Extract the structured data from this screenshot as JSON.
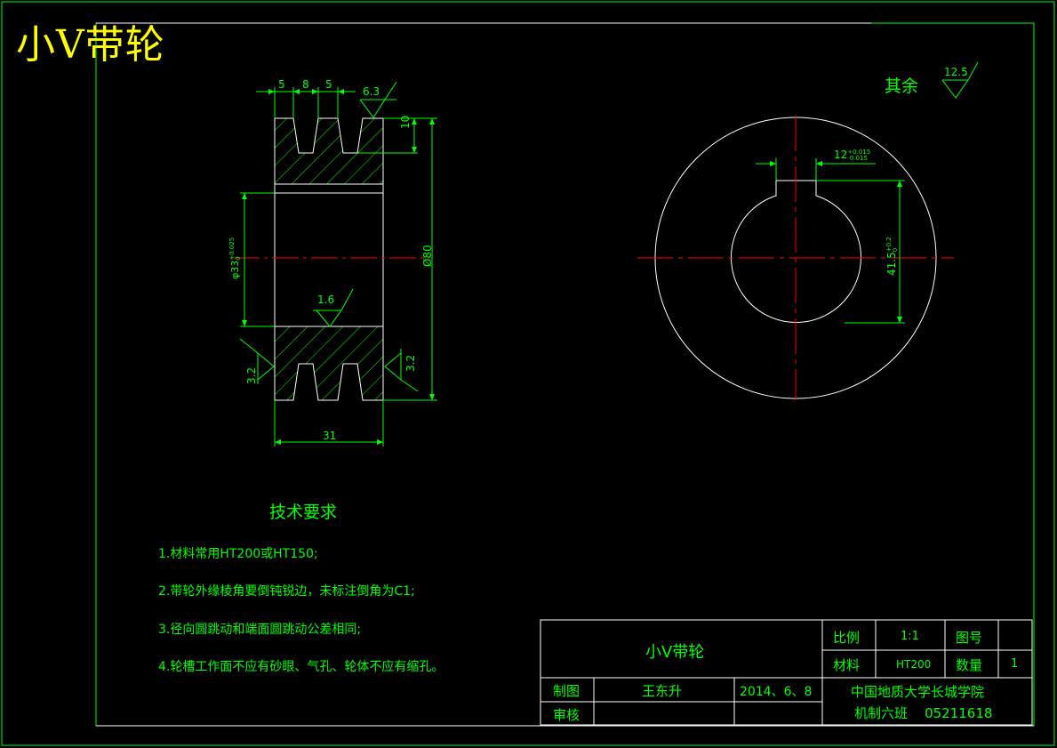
{
  "header": {
    "title": "小V带轮"
  },
  "drawing": {
    "section": {
      "dim_top": [
        "5",
        "8",
        "5"
      ],
      "roughness_top": "6.3",
      "dim_groove_depth": "10",
      "dim_bore": "φ33",
      "dim_bore_tol_upper": "+0.025",
      "dim_bore_tol_lower": "0",
      "dim_outer": "Ø80",
      "roughness_bore": "1.6",
      "roughness_left": "3.2",
      "roughness_right": "3.2",
      "dim_width": "31"
    },
    "end_view": {
      "dim_keyway": "12",
      "dim_keyway_tol_upper": "+0.015",
      "dim_keyway_tol_lower": "-0.015",
      "dim_keyhub": "41.5",
      "dim_keyhub_tol_upper": "+0.2",
      "dim_keyhub_tol_lower": "0"
    },
    "roughness_rest_label": "其余",
    "roughness_rest_value": "12.5"
  },
  "tech": {
    "title": "技术要求",
    "items": [
      "1.材料常用HT200或HT150;",
      "2.带轮外缘棱角要倒钝锐边，未标注倒角为C1;",
      "3.径向圆跳动和端面圆跳动公差相同;",
      "4.轮槽工作面不应有砂眼、气孔、轮体不应有缩孔。"
    ]
  },
  "title_block": {
    "part_name": "小V带轮",
    "scale_label": "比例",
    "scale_value": "1:1",
    "drawing_no_label": "图号",
    "drawing_no_value": "",
    "material_label": "材料",
    "material_value": "HT200",
    "qty_label": "数量",
    "qty_value": "1",
    "drawn_label": "制图",
    "drawn_name": "王东升",
    "drawn_date": "2014、6、8",
    "check_label": "审核",
    "org_line1": "中国地质大学长城学院",
    "org_line2": "机制六班    05211618"
  },
  "colors": {
    "line": "#ffffff",
    "dim": "#00ff00",
    "center": "#ff0000",
    "title": "#ffff00"
  }
}
